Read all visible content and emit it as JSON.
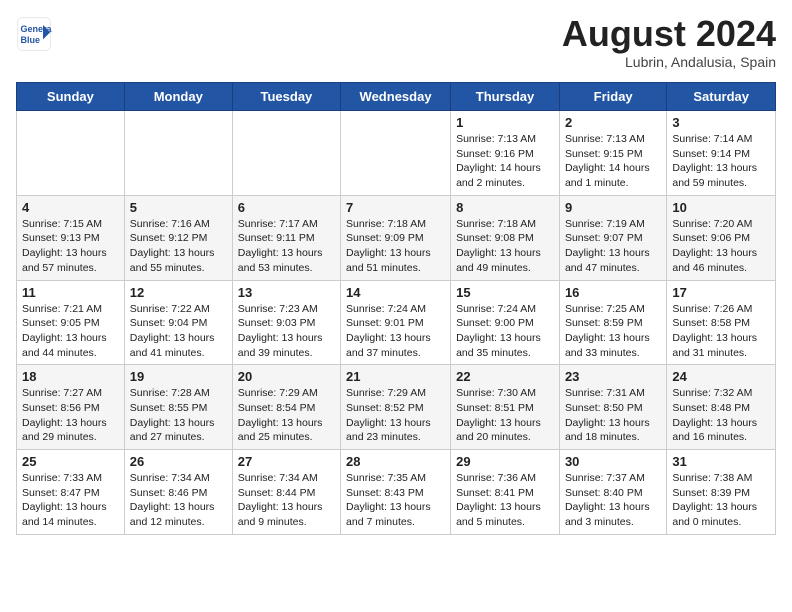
{
  "logo": {
    "line1": "General",
    "line2": "Blue"
  },
  "title": "August 2024",
  "location": "Lubrin, Andalusia, Spain",
  "days_of_week": [
    "Sunday",
    "Monday",
    "Tuesday",
    "Wednesday",
    "Thursday",
    "Friday",
    "Saturday"
  ],
  "weeks": [
    [
      {
        "day": "",
        "info": ""
      },
      {
        "day": "",
        "info": ""
      },
      {
        "day": "",
        "info": ""
      },
      {
        "day": "",
        "info": ""
      },
      {
        "day": "1",
        "info": "Sunrise: 7:13 AM\nSunset: 9:16 PM\nDaylight: 14 hours\nand 2 minutes."
      },
      {
        "day": "2",
        "info": "Sunrise: 7:13 AM\nSunset: 9:15 PM\nDaylight: 14 hours\nand 1 minute."
      },
      {
        "day": "3",
        "info": "Sunrise: 7:14 AM\nSunset: 9:14 PM\nDaylight: 13 hours\nand 59 minutes."
      }
    ],
    [
      {
        "day": "4",
        "info": "Sunrise: 7:15 AM\nSunset: 9:13 PM\nDaylight: 13 hours\nand 57 minutes."
      },
      {
        "day": "5",
        "info": "Sunrise: 7:16 AM\nSunset: 9:12 PM\nDaylight: 13 hours\nand 55 minutes."
      },
      {
        "day": "6",
        "info": "Sunrise: 7:17 AM\nSunset: 9:11 PM\nDaylight: 13 hours\nand 53 minutes."
      },
      {
        "day": "7",
        "info": "Sunrise: 7:18 AM\nSunset: 9:09 PM\nDaylight: 13 hours\nand 51 minutes."
      },
      {
        "day": "8",
        "info": "Sunrise: 7:18 AM\nSunset: 9:08 PM\nDaylight: 13 hours\nand 49 minutes."
      },
      {
        "day": "9",
        "info": "Sunrise: 7:19 AM\nSunset: 9:07 PM\nDaylight: 13 hours\nand 47 minutes."
      },
      {
        "day": "10",
        "info": "Sunrise: 7:20 AM\nSunset: 9:06 PM\nDaylight: 13 hours\nand 46 minutes."
      }
    ],
    [
      {
        "day": "11",
        "info": "Sunrise: 7:21 AM\nSunset: 9:05 PM\nDaylight: 13 hours\nand 44 minutes."
      },
      {
        "day": "12",
        "info": "Sunrise: 7:22 AM\nSunset: 9:04 PM\nDaylight: 13 hours\nand 41 minutes."
      },
      {
        "day": "13",
        "info": "Sunrise: 7:23 AM\nSunset: 9:03 PM\nDaylight: 13 hours\nand 39 minutes."
      },
      {
        "day": "14",
        "info": "Sunrise: 7:24 AM\nSunset: 9:01 PM\nDaylight: 13 hours\nand 37 minutes."
      },
      {
        "day": "15",
        "info": "Sunrise: 7:24 AM\nSunset: 9:00 PM\nDaylight: 13 hours\nand 35 minutes."
      },
      {
        "day": "16",
        "info": "Sunrise: 7:25 AM\nSunset: 8:59 PM\nDaylight: 13 hours\nand 33 minutes."
      },
      {
        "day": "17",
        "info": "Sunrise: 7:26 AM\nSunset: 8:58 PM\nDaylight: 13 hours\nand 31 minutes."
      }
    ],
    [
      {
        "day": "18",
        "info": "Sunrise: 7:27 AM\nSunset: 8:56 PM\nDaylight: 13 hours\nand 29 minutes."
      },
      {
        "day": "19",
        "info": "Sunrise: 7:28 AM\nSunset: 8:55 PM\nDaylight: 13 hours\nand 27 minutes."
      },
      {
        "day": "20",
        "info": "Sunrise: 7:29 AM\nSunset: 8:54 PM\nDaylight: 13 hours\nand 25 minutes."
      },
      {
        "day": "21",
        "info": "Sunrise: 7:29 AM\nSunset: 8:52 PM\nDaylight: 13 hours\nand 23 minutes."
      },
      {
        "day": "22",
        "info": "Sunrise: 7:30 AM\nSunset: 8:51 PM\nDaylight: 13 hours\nand 20 minutes."
      },
      {
        "day": "23",
        "info": "Sunrise: 7:31 AM\nSunset: 8:50 PM\nDaylight: 13 hours\nand 18 minutes."
      },
      {
        "day": "24",
        "info": "Sunrise: 7:32 AM\nSunset: 8:48 PM\nDaylight: 13 hours\nand 16 minutes."
      }
    ],
    [
      {
        "day": "25",
        "info": "Sunrise: 7:33 AM\nSunset: 8:47 PM\nDaylight: 13 hours\nand 14 minutes."
      },
      {
        "day": "26",
        "info": "Sunrise: 7:34 AM\nSunset: 8:46 PM\nDaylight: 13 hours\nand 12 minutes."
      },
      {
        "day": "27",
        "info": "Sunrise: 7:34 AM\nSunset: 8:44 PM\nDaylight: 13 hours\nand 9 minutes."
      },
      {
        "day": "28",
        "info": "Sunrise: 7:35 AM\nSunset: 8:43 PM\nDaylight: 13 hours\nand 7 minutes."
      },
      {
        "day": "29",
        "info": "Sunrise: 7:36 AM\nSunset: 8:41 PM\nDaylight: 13 hours\nand 5 minutes."
      },
      {
        "day": "30",
        "info": "Sunrise: 7:37 AM\nSunset: 8:40 PM\nDaylight: 13 hours\nand 3 minutes."
      },
      {
        "day": "31",
        "info": "Sunrise: 7:38 AM\nSunset: 8:39 PM\nDaylight: 13 hours\nand 0 minutes."
      }
    ]
  ]
}
